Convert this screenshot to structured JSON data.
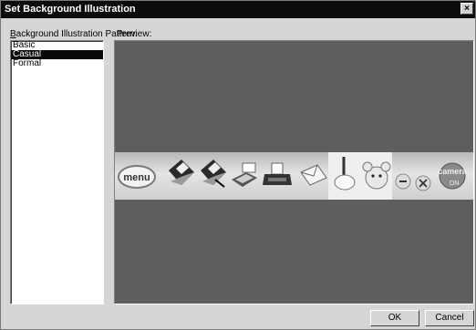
{
  "window": {
    "title": "Set Background Illustration",
    "close_glyph": "×"
  },
  "labels": {
    "pattern_prefix": "B",
    "pattern_rest": "ackground Illustration Pattern:",
    "preview": "Preview:"
  },
  "patterns": [
    {
      "label": "Basic",
      "selected": false
    },
    {
      "label": "Casual",
      "selected": true
    },
    {
      "label": "Formal",
      "selected": false
    }
  ],
  "preview_toolbar": {
    "menu_label": "menu",
    "icons": [
      "menu-button-icon",
      "floppy-disk-icon",
      "floppy-disk-edit-icon",
      "scanner-icon",
      "printer-icon",
      "envelope-icon",
      "pen-pot-icon",
      "character-face-icon",
      "minimize-dot-icon",
      "close-dot-icon",
      "camera-icon"
    ],
    "camera_label": "camera",
    "colors": {
      "strip_light": "#e4e4e4",
      "strip_dark": "#b8b8b8",
      "preview_bg": "#5e5e5e"
    }
  },
  "buttons": {
    "ok": "OK",
    "cancel": "Cancel"
  }
}
